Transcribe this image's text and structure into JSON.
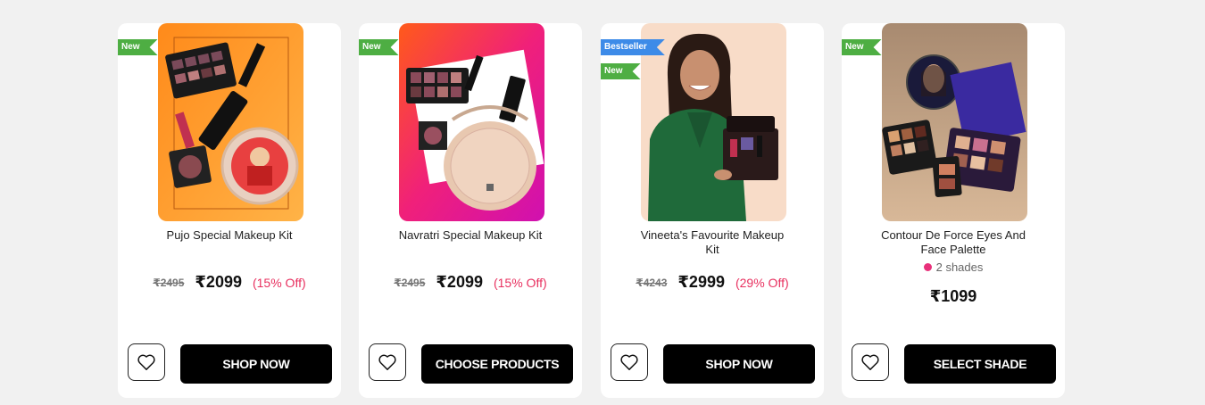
{
  "products": [
    {
      "name": "Pujo Special Makeup Kit",
      "badges": [
        "New"
      ],
      "mrp": "₹2495",
      "price": "₹2099",
      "discount": "(15% Off)",
      "cta": "SHOP NOW"
    },
    {
      "name": "Navratri Special Makeup Kit",
      "badges": [
        "New"
      ],
      "mrp": "₹2495",
      "price": "₹2099",
      "discount": "(15% Off)",
      "cta": "CHOOSE PRODUCTS"
    },
    {
      "name": "Vineeta's Favourite Makeup Kit",
      "badges": [
        "Bestseller",
        "New"
      ],
      "mrp": "₹4243",
      "price": "₹2999",
      "discount": "(29% Off)",
      "cta": "SHOP NOW"
    },
    {
      "name": "Contour De Force Eyes And Face Palette",
      "badges": [
        "New"
      ],
      "shades": "2 shades",
      "price": "₹1099",
      "cta": "SELECT SHADE"
    }
  ],
  "colors": {
    "new_badge": "#4eae43",
    "bestseller_badge": "#3d8be8",
    "discount": "#e8305f",
    "cta_bg": "#000000"
  },
  "icons": {
    "wishlist": "heart-outline-icon"
  }
}
